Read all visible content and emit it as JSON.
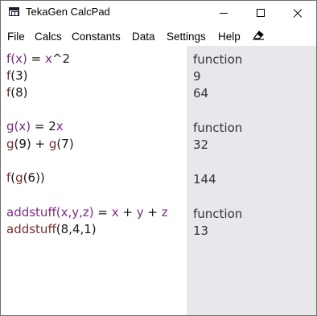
{
  "window": {
    "title": "TekaGen CalcPad"
  },
  "menu": {
    "items": [
      "File",
      "Calcs",
      "Constants",
      "Data",
      "Settings",
      "Help"
    ]
  },
  "editor": {
    "l1": {
      "a": "f(x)",
      "b": " = ",
      "c": "x",
      "d": "^2"
    },
    "l2": {
      "a": "f",
      "b": "(3)"
    },
    "l3": {
      "a": "f",
      "b": "(8)"
    },
    "l4": {
      "a": "g(x)",
      "b": " = 2",
      "c": "x"
    },
    "l5": {
      "a": "g",
      "b": "(9) + ",
      "c": "g",
      "d": "(7)"
    },
    "l6": {
      "a": "f",
      "b": "(",
      "c": "g",
      "d": "(6))"
    },
    "l7": {
      "a": "addstuff(x,y,z)",
      "b": " = ",
      "c": "x",
      "d": " + ",
      "e": "y",
      "f": " + ",
      "g": "z"
    },
    "l8": {
      "a": "addstuff",
      "b": "(8,4,1)"
    }
  },
  "results": {
    "r1": "function",
    "r2": "9",
    "r3": "64",
    "r4": "function",
    "r5": "32",
    "r6": "144",
    "r7": "function",
    "r8": "13"
  }
}
